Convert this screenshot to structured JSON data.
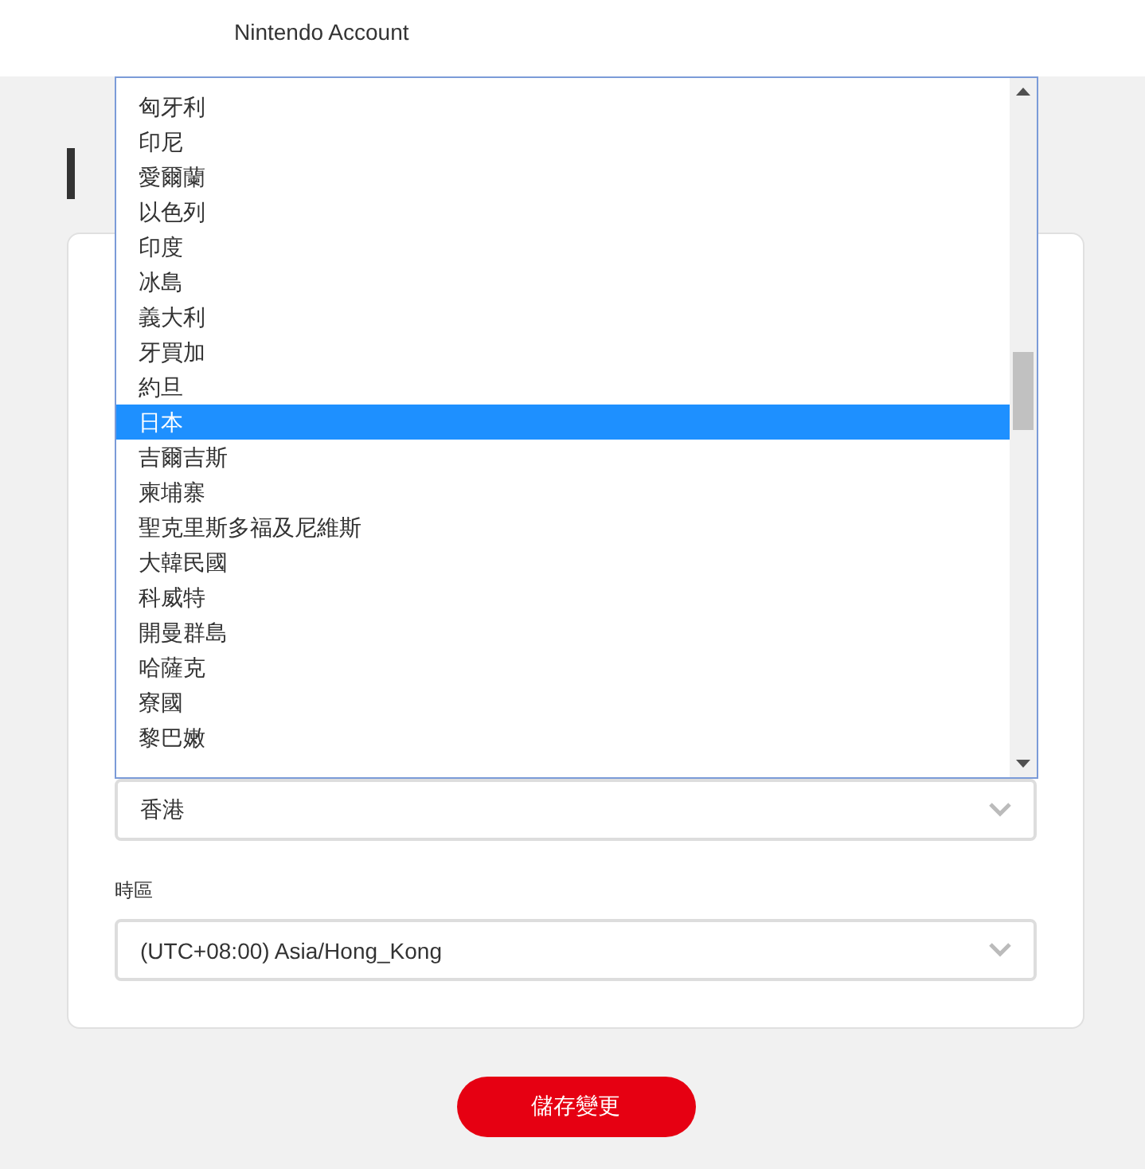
{
  "header": {
    "title": "Nintendo Account"
  },
  "region_select": {
    "value": "香港",
    "expanded": true
  },
  "dropdown": {
    "options": [
      {
        "label": "匈牙利",
        "selected": false
      },
      {
        "label": "印尼",
        "selected": false
      },
      {
        "label": "愛爾蘭",
        "selected": false
      },
      {
        "label": "以色列",
        "selected": false
      },
      {
        "label": "印度",
        "selected": false
      },
      {
        "label": "冰島",
        "selected": false
      },
      {
        "label": "義大利",
        "selected": false
      },
      {
        "label": "牙買加",
        "selected": false
      },
      {
        "label": "約旦",
        "selected": false
      },
      {
        "label": "日本",
        "selected": true
      },
      {
        "label": "吉爾吉斯",
        "selected": false
      },
      {
        "label": "柬埔寨",
        "selected": false
      },
      {
        "label": "聖克里斯多福及尼維斯",
        "selected": false
      },
      {
        "label": "大韓民國",
        "selected": false
      },
      {
        "label": "科威特",
        "selected": false
      },
      {
        "label": "開曼群島",
        "selected": false
      },
      {
        "label": "哈薩克",
        "selected": false
      },
      {
        "label": "寮國",
        "selected": false
      },
      {
        "label": "黎巴嫩",
        "selected": false
      }
    ]
  },
  "timezone": {
    "label": "時區",
    "value": "(UTC+08:00) Asia/Hong_Kong"
  },
  "save_button": "儲存變更"
}
